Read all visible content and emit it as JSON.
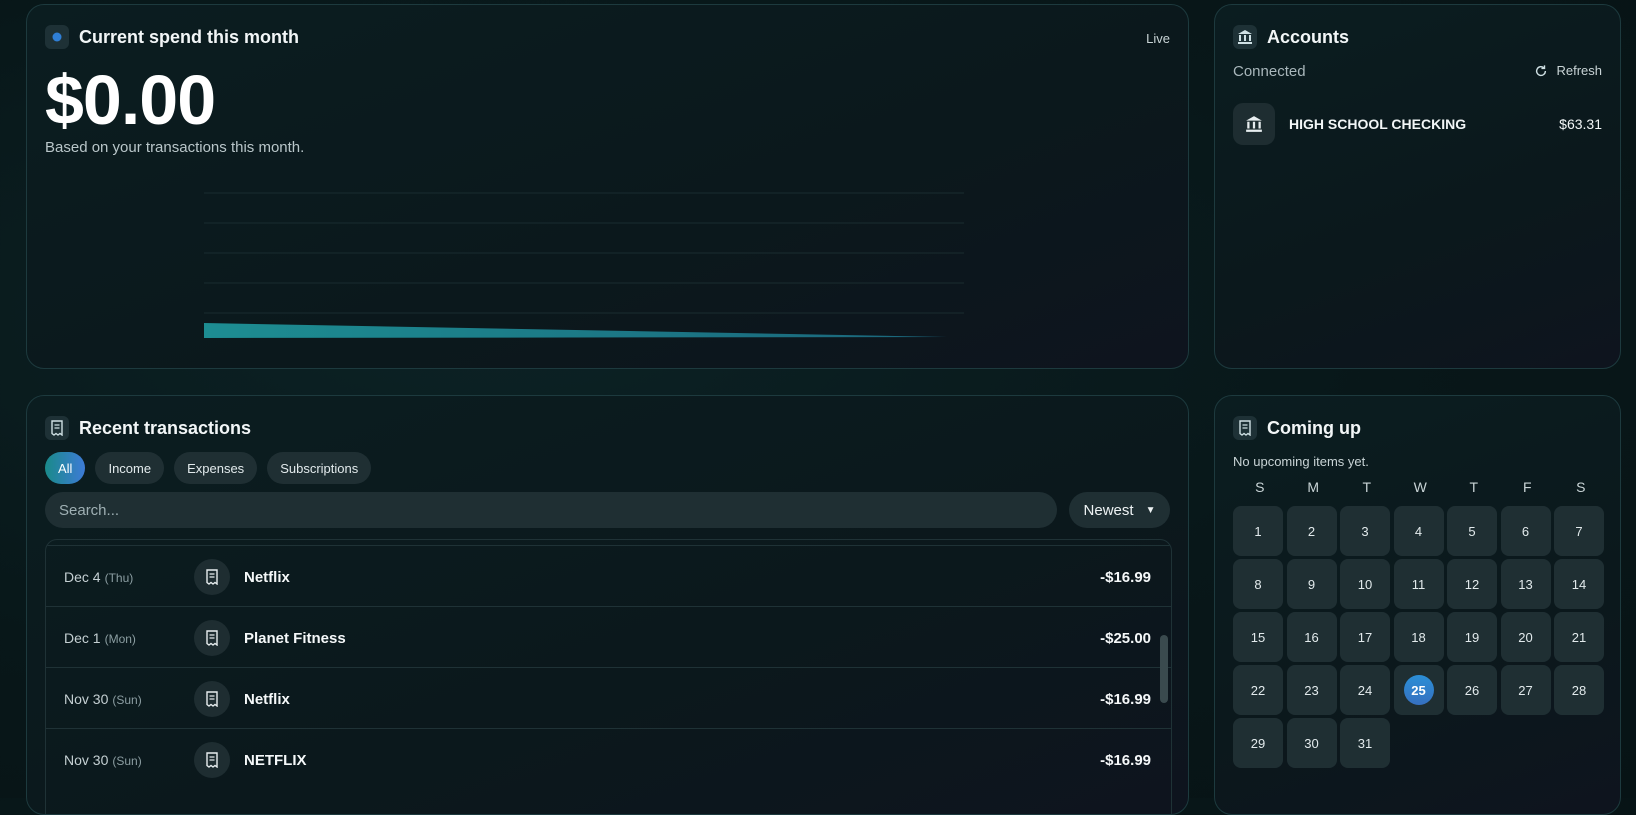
{
  "spend": {
    "title": "Current spend this month",
    "status": "Live",
    "amount": "$0.00",
    "subtitle": "Based on your transactions this month."
  },
  "accounts": {
    "title": "Accounts",
    "connected_label": "Connected",
    "refresh_label": "Refresh",
    "items": [
      {
        "name": "HIGH SCHOOL CHECKING",
        "balance": "$63.31"
      }
    ]
  },
  "transactions": {
    "title": "Recent transactions",
    "filters": [
      "All",
      "Income",
      "Expenses",
      "Subscriptions"
    ],
    "active_filter": "All",
    "search_placeholder": "Search...",
    "sort_label": "Newest",
    "rows": [
      {
        "date": "Dec 4",
        "dow": "(Thu)",
        "name": "Netflix",
        "amount": "-$16.99"
      },
      {
        "date": "Dec 1",
        "dow": "(Mon)",
        "name": "Planet Fitness",
        "amount": "-$25.00"
      },
      {
        "date": "Nov 30",
        "dow": "(Sun)",
        "name": "Netflix",
        "amount": "-$16.99"
      },
      {
        "date": "Nov 30",
        "dow": "(Sun)",
        "name": "NETFLIX",
        "amount": "-$16.99"
      }
    ]
  },
  "coming_up": {
    "title": "Coming up",
    "empty_text": "No upcoming items yet.",
    "weekdays": [
      "S",
      "M",
      "T",
      "W",
      "T",
      "F",
      "S"
    ],
    "days": [
      "1",
      "2",
      "3",
      "4",
      "5",
      "6",
      "7",
      "8",
      "9",
      "10",
      "11",
      "12",
      "13",
      "14",
      "15",
      "16",
      "17",
      "18",
      "19",
      "20",
      "21",
      "22",
      "23",
      "24",
      "25",
      "26",
      "27",
      "28",
      "29",
      "30",
      "31"
    ],
    "today": "25"
  },
  "colors": {
    "accent_teal": "#1a8a8a",
    "accent_blue": "#3d7bd6",
    "chart_fill": "#1c8f96"
  },
  "icons": {
    "spend": "dot-icon",
    "accounts": "bank-icon",
    "transactions": "receipt-icon",
    "coming_up": "receipt-icon",
    "refresh": "refresh-icon"
  }
}
